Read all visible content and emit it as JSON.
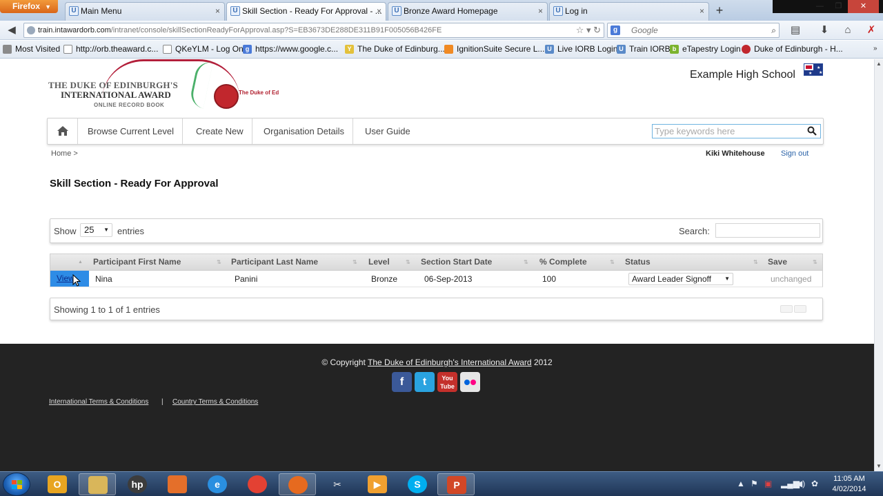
{
  "browser": {
    "app_button": "Firefox",
    "tabs": [
      {
        "label": "Main Menu",
        "active": false
      },
      {
        "label": "Skill Section - Ready For Approval - ...",
        "active": true
      },
      {
        "label": "Bronze Award Homepage",
        "active": false
      },
      {
        "label": "Log in",
        "active": false
      }
    ],
    "url_domain": "train.intawardorb.com",
    "url_path": "/intranet/console/skillSectionReadyForApproval.asp?S=EB3673DE288DE311B91F005056B426FE",
    "search_placeholder": "Google",
    "bookmarks": [
      {
        "label": "Most Visited",
        "icon": "gear-icon"
      },
      {
        "label": "http://orb.theaward.c...",
        "icon": "page-icon"
      },
      {
        "label": "QKeYLM - Log On",
        "icon": "page-icon"
      },
      {
        "label": "https://www.google.c...",
        "icon": "google-icon"
      },
      {
        "label": "The Duke of Edinburg...",
        "icon": "award-icon"
      },
      {
        "label": "IgnitionSuite Secure L...",
        "icon": "ignition-icon"
      },
      {
        "label": "Live IORB Login",
        "icon": "iorb-icon"
      },
      {
        "label": "Train IORB",
        "icon": "iorb-icon"
      },
      {
        "label": "eTapestry Login",
        "icon": "etapestry-icon"
      },
      {
        "label": "Duke of Edinburgh - H...",
        "icon": "award-icon"
      }
    ]
  },
  "header": {
    "logo_line1": "THE DUKE OF EDINBURGH'S",
    "logo_line2": "INTERNATIONAL AWARD",
    "logo_line3": "ONLINE RECORD BOOK",
    "seal_text": "The Duke of Ed",
    "school": "Example High School"
  },
  "menu": {
    "items": [
      "Browse Current Level",
      "Create New",
      "Organisation Details",
      "User Guide"
    ],
    "search_placeholder": "Type keywords here"
  },
  "breadcrumb": "Home >",
  "user": {
    "name": "Kiki Whitehouse",
    "signout": "Sign out"
  },
  "page_title": "Skill Section - Ready For Approval",
  "table_controls": {
    "show": "Show",
    "page_length": "25",
    "entries": "entries",
    "search_label": "Search:"
  },
  "table": {
    "columns": [
      "",
      "Participant First Name",
      "Participant Last Name",
      "Level",
      "Section Start Date",
      "% Complete",
      "Status",
      "Save"
    ],
    "rows": [
      {
        "action": "View",
        "first_name": "Nina",
        "last_name": "Panini",
        "level": "Bronze",
        "start_date": "06-Sep-2013",
        "complete": "100",
        "status": "Award Leader Signoff",
        "save": "unchanged"
      }
    ],
    "info": "Showing 1 to 1 of 1 entries"
  },
  "footer": {
    "copyright_prefix": "© Copyright",
    "org": "The Duke of Edinburgh's International Award",
    "year": "2012",
    "socials": [
      "facebook-icon",
      "twitter-icon",
      "youtube-icon",
      "flickr-icon"
    ],
    "terms_international": "International Terms & Conditions",
    "terms_separator": "|",
    "terms_country": "Country Terms & Conditions"
  },
  "taskbar": {
    "time": "11:05 AM",
    "date": "4/02/2014"
  },
  "colors": {
    "view_cell": "#2e8ce6",
    "footer_bg": "#232323",
    "link": "#2b63a8"
  }
}
